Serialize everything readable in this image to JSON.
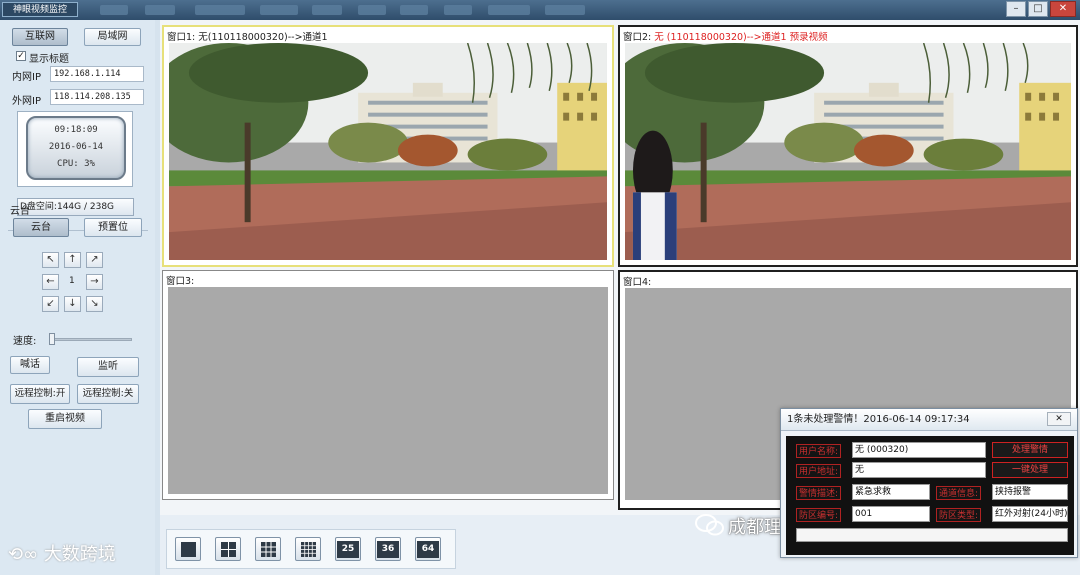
{
  "app": {
    "title": "神眼视频监控"
  },
  "left": {
    "internet_btn": "互联网",
    "lan_btn": "局域网",
    "show_title_label": "显示标题",
    "show_title_checked": true,
    "inner_ip_label": "内网IP",
    "inner_ip": "192.168.1.114",
    "outer_ip_label": "外网IP",
    "outer_ip": "118.114.208.135",
    "time": "09:18:09",
    "date": "2016-06-14",
    "cpu": "CPU: 3%",
    "disk": "D盘空间:144G / 238G",
    "ptz_section": "云台",
    "ptz_btn": "云台",
    "preset_btn": "预置位",
    "arrows": {
      "up_left": "↖",
      "up": "↑",
      "up_right": "↗",
      "left": "←",
      "center": "1",
      "right": "→",
      "down_left": "↙",
      "down": "↓",
      "down_right": "↘"
    },
    "speed_label": "速度:",
    "speed_level": 0,
    "talk_btn": "喊话",
    "listen_btn": "监听",
    "remote_on_btn": "远程控制:开",
    "remote_off_btn": "远程控制:关",
    "restart_btn": "重启视频"
  },
  "panes": {
    "p1_prefix": "窗口1:",
    "p1_title": "无(110118000320)-->通道1",
    "p2_prefix": "窗口2:",
    "p2_title": "无 (110118000320)-->通道1 预录视频",
    "p3_title": "窗口3:",
    "p4_title": "窗口4:"
  },
  "layouts": [
    "1",
    "4",
    "9",
    "16",
    "25",
    "36",
    "64"
  ],
  "alarm": {
    "header": "1条未处理警情！2016-06-14 09:17:34",
    "close": "✕",
    "user_name_label": "用户名称:",
    "user_name": "无 (000320)",
    "user_addr_label": "用户地址:",
    "user_addr": "无",
    "alarm_desc_label": "警情描述:",
    "alarm_desc": "紧急求救",
    "channel_label": "通道信息:",
    "channel": "挟持报警",
    "defense_label": "防区编号:",
    "defense": "001",
    "zone_label": "防区类型:",
    "zone": "红外对射(24小时)",
    "handle_btn": "处理警情",
    "one_key_btn": "一键处理"
  },
  "watermark": {
    "left": "大数跨境",
    "right": "成都理想科技开发有限公司"
  },
  "colors": {
    "accent_red": "#d22222",
    "selected_pane": "#e7e07a",
    "toolbar": "#2f4d6b"
  }
}
